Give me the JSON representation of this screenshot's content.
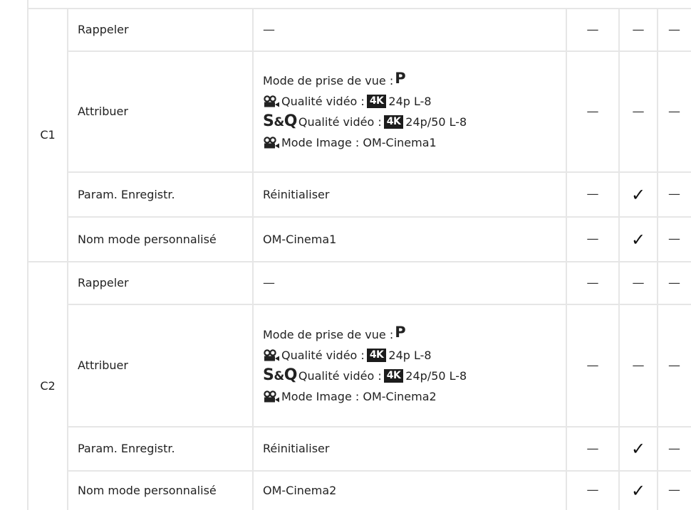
{
  "modes": [
    {
      "mode": "C1",
      "rows": [
        {
          "param": "Rappeler",
          "value": "—",
          "flags": [
            "—",
            "—",
            "—"
          ]
        },
        {
          "param": "Attribuer",
          "lines": {
            "shooting_mode_label": "Mode de prise de vue : ",
            "shooting_mode_value": "P",
            "video_quality_label": "Qualité vidéo : ",
            "video_quality_badge": "4K",
            "video_quality_value": "24p L-8",
            "sq_prefix_s": "S",
            "sq_prefix_amp": "&",
            "sq_prefix_q": "Q",
            "sq_quality_label": "Qualité vidéo : ",
            "sq_quality_badge": "4K",
            "sq_quality_value": "24p/50 L-8",
            "picture_mode_text": "Mode Image : OM-Cinema1"
          },
          "flags": [
            "—",
            "—",
            "—"
          ]
        },
        {
          "param": "Param. Enregistr.",
          "value": "Réinitialiser",
          "flags": [
            "—",
            "✓",
            "—"
          ]
        },
        {
          "param": "Nom mode personnalisé",
          "value": "OM-Cinema1",
          "flags": [
            "—",
            "✓",
            "—"
          ]
        }
      ]
    },
    {
      "mode": "C2",
      "rows": [
        {
          "param": "Rappeler",
          "value": "—",
          "flags": [
            "—",
            "—",
            "—"
          ]
        },
        {
          "param": "Attribuer",
          "lines": {
            "shooting_mode_label": "Mode de prise de vue : ",
            "shooting_mode_value": "P",
            "video_quality_label": "Qualité vidéo : ",
            "video_quality_badge": "4K",
            "video_quality_value": "24p L-8",
            "sq_prefix_s": "S",
            "sq_prefix_amp": "&",
            "sq_prefix_q": "Q",
            "sq_quality_label": "Qualité vidéo : ",
            "sq_quality_badge": "4K",
            "sq_quality_value": "24p/50 L-8",
            "picture_mode_text": "Mode Image : OM-Cinema2"
          },
          "flags": [
            "—",
            "—",
            "—"
          ]
        },
        {
          "param": "Param. Enregistr.",
          "value": "Réinitialiser",
          "flags": [
            "—",
            "✓",
            "—"
          ]
        },
        {
          "param": "Nom mode personnalisé",
          "value": "OM-Cinema2",
          "flags": [
            "—",
            "✓",
            "—"
          ]
        }
      ]
    }
  ]
}
